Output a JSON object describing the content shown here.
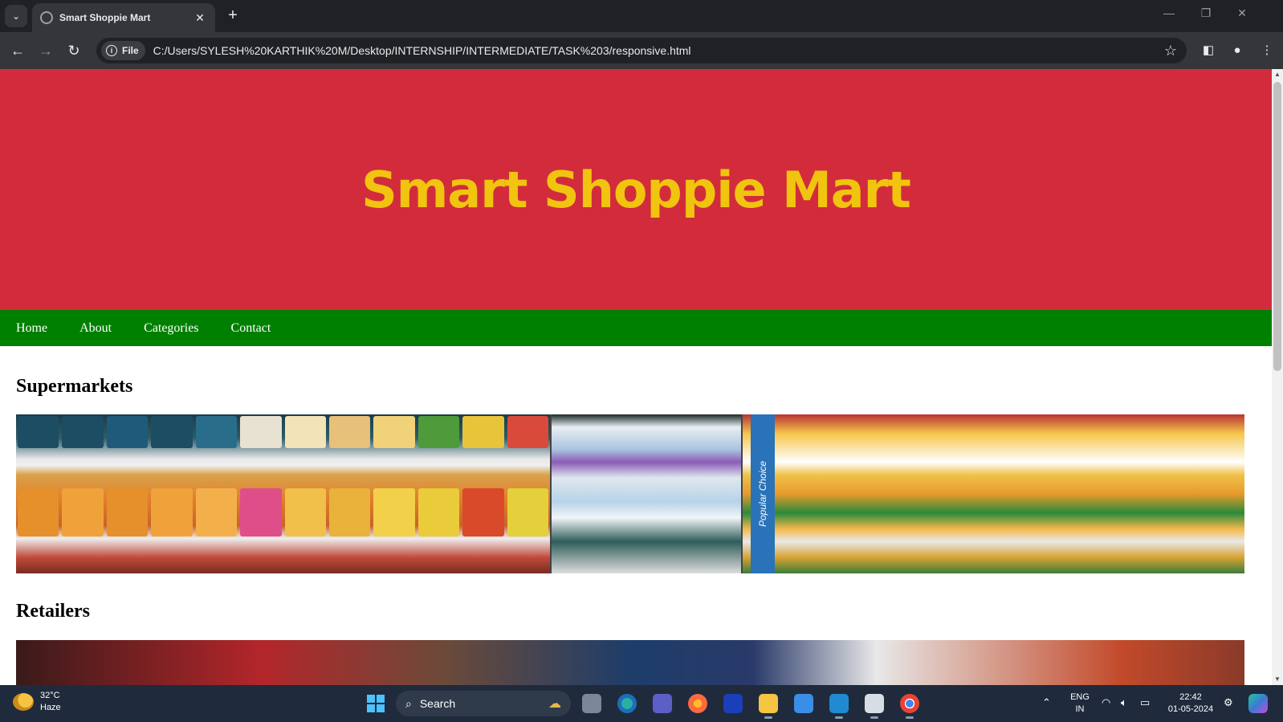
{
  "browser": {
    "tab_title": "Smart Shoppie Mart",
    "new_tab": "+",
    "url_chip": "File",
    "url": "C:/Users/SYLESH%20KARTHIK%20M/Desktop/INTERNSHIP/INTERMEDIATE/TASK%203/responsive.html",
    "window_controls": [
      "—",
      "❐",
      "✕"
    ]
  },
  "page": {
    "hero_title": "Smart Shoppie Mart",
    "nav": [
      "Home",
      "About",
      "Categories",
      "Contact"
    ],
    "sections": [
      {
        "heading": "Supermarkets",
        "side_sign": "Popular Choice"
      },
      {
        "heading": "Retailers"
      }
    ],
    "colors": {
      "hero_bg": "#d22c3c",
      "hero_text": "#f1c40f",
      "nav_bg": "#008000"
    }
  },
  "taskbar": {
    "weather_temp": "32°C",
    "weather_desc": "Haze",
    "search_label": "Search",
    "lang_top": "ENG",
    "lang_bottom": "IN",
    "time": "22:42",
    "date": "01-05-2024"
  }
}
